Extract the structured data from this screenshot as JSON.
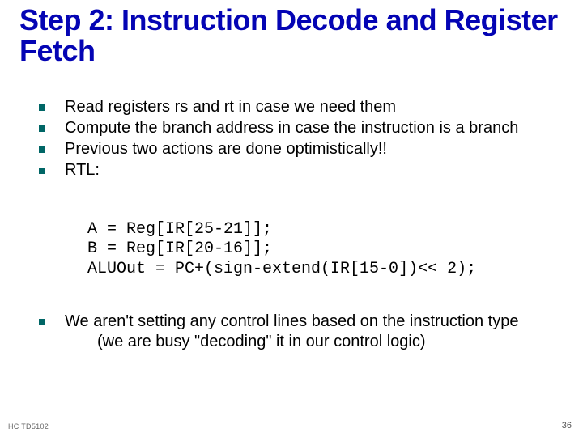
{
  "title": "Step 2: Instruction Decode and Register Fetch",
  "bullets1": {
    "b0": "Read registers rs and rt in case we need them",
    "b1": "Compute the branch address in case the instruction is a branch",
    "b2": "Previous two actions are done optimistically!!",
    "b3": "RTL:"
  },
  "code": {
    "l0": "A = Reg[IR[25-21]];",
    "l1": "B = Reg[IR[20-16]];",
    "l2": "ALUOut = PC+(sign-extend(IR[15-0])<< 2);"
  },
  "bullets2": {
    "b0": "We aren't setting any control lines based on the instruction type",
    "b0sub": "(we are busy \"decoding\" it in our control logic)"
  },
  "footer": {
    "left": "HC TD5102",
    "right": "36"
  }
}
